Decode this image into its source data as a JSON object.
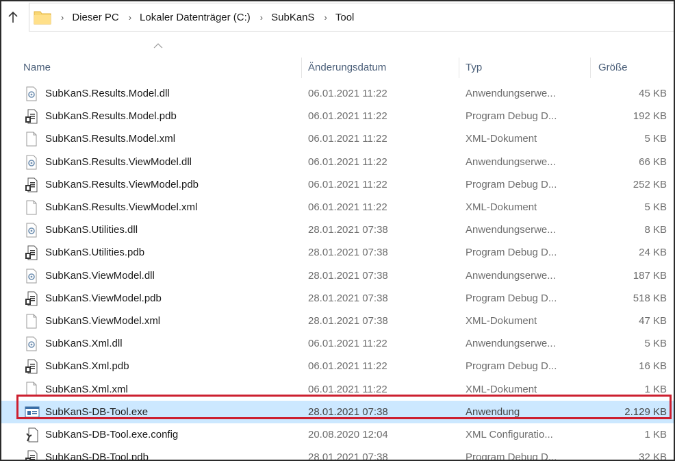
{
  "breadcrumb": [
    "Dieser PC",
    "Lokaler Datenträger (C:)",
    "SubKanS",
    "Tool"
  ],
  "columns": {
    "name": "Name",
    "date": "Änderungsdatum",
    "type": "Typ",
    "size": "Größe"
  },
  "files": [
    {
      "name": "SubKanS.Results.Model.dll",
      "date": "06.01.2021 11:22",
      "type": "Anwendungserwe...",
      "size": "45 KB",
      "icon": "dll-icon"
    },
    {
      "name": "SubKanS.Results.Model.pdb",
      "date": "06.01.2021 11:22",
      "type": "Program Debug D...",
      "size": "192 KB",
      "icon": "pdb-icon"
    },
    {
      "name": "SubKanS.Results.Model.xml",
      "date": "06.01.2021 11:22",
      "type": "XML-Dokument",
      "size": "5 KB",
      "icon": "blank-file-icon"
    },
    {
      "name": "SubKanS.Results.ViewModel.dll",
      "date": "06.01.2021 11:22",
      "type": "Anwendungserwe...",
      "size": "66 KB",
      "icon": "dll-icon"
    },
    {
      "name": "SubKanS.Results.ViewModel.pdb",
      "date": "06.01.2021 11:22",
      "type": "Program Debug D...",
      "size": "252 KB",
      "icon": "pdb-icon"
    },
    {
      "name": "SubKanS.Results.ViewModel.xml",
      "date": "06.01.2021 11:22",
      "type": "XML-Dokument",
      "size": "5 KB",
      "icon": "blank-file-icon"
    },
    {
      "name": "SubKanS.Utilities.dll",
      "date": "28.01.2021 07:38",
      "type": "Anwendungserwe...",
      "size": "8 KB",
      "icon": "dll-icon"
    },
    {
      "name": "SubKanS.Utilities.pdb",
      "date": "28.01.2021 07:38",
      "type": "Program Debug D...",
      "size": "24 KB",
      "icon": "pdb-icon"
    },
    {
      "name": "SubKanS.ViewModel.dll",
      "date": "28.01.2021 07:38",
      "type": "Anwendungserwe...",
      "size": "187 KB",
      "icon": "dll-icon"
    },
    {
      "name": "SubKanS.ViewModel.pdb",
      "date": "28.01.2021 07:38",
      "type": "Program Debug D...",
      "size": "518 KB",
      "icon": "pdb-icon"
    },
    {
      "name": "SubKanS.ViewModel.xml",
      "date": "28.01.2021 07:38",
      "type": "XML-Dokument",
      "size": "47 KB",
      "icon": "blank-file-icon"
    },
    {
      "name": "SubKanS.Xml.dll",
      "date": "06.01.2021 11:22",
      "type": "Anwendungserwe...",
      "size": "5 KB",
      "icon": "dll-icon"
    },
    {
      "name": "SubKanS.Xml.pdb",
      "date": "06.01.2021 11:22",
      "type": "Program Debug D...",
      "size": "16 KB",
      "icon": "pdb-icon"
    },
    {
      "name": "SubKanS.Xml.xml",
      "date": "06.01.2021 11:22",
      "type": "XML-Dokument",
      "size": "1 KB",
      "icon": "blank-file-icon"
    },
    {
      "name": "SubKanS-DB-Tool.exe",
      "date": "28.01.2021 07:38",
      "type": "Anwendung",
      "size": "2.129 KB",
      "icon": "exe-icon",
      "selected": true
    },
    {
      "name": "SubKanS-DB-Tool.exe.config",
      "date": "20.08.2020 12:04",
      "type": "XML Configuratio...",
      "size": "1 KB",
      "icon": "config-icon"
    },
    {
      "name": "SubKanS-DB-Tool.pdb",
      "date": "28.01.2021 07:38",
      "type": "Program Debug D...",
      "size": "32 KB",
      "icon": "pdb-icon"
    }
  ],
  "colors": {
    "selection": "#cce8ff",
    "highlight_border": "#cc1f2f",
    "header_text": "#4c607a"
  }
}
